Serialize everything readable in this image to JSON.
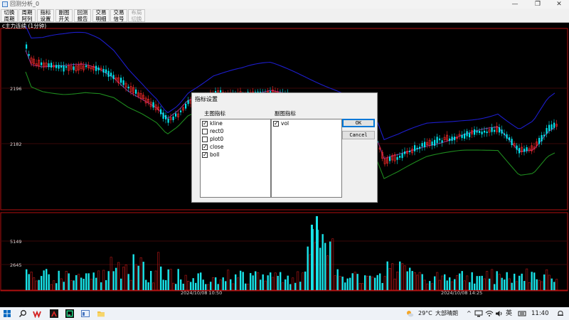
{
  "window": {
    "title": "回测分析_0",
    "controls": [
      "—",
      "❐",
      "✕"
    ]
  },
  "toolbar": {
    "buttons": [
      {
        "line1": "切换",
        "line2": "周期",
        "enabled": true
      },
      {
        "line1": "周期",
        "line2": "阿列",
        "enabled": true
      },
      {
        "line1": "指标",
        "line2": "设置",
        "enabled": true
      },
      {
        "line1": "副图",
        "line2": "开关",
        "enabled": true
      },
      {
        "line1": "回测",
        "line2": "报告",
        "enabled": true
      },
      {
        "line1": "交易",
        "line2": "明细",
        "enabled": true
      },
      {
        "line1": "交易",
        "line2": "信号",
        "enabled": true
      },
      {
        "line1": "布局",
        "line2": "切换",
        "enabled": false
      }
    ]
  },
  "chart": {
    "symbol_label": "c主力连续 (1分钟)",
    "main_ticks": [
      "2196",
      "2182"
    ],
    "sub_ticks": [
      "5149",
      "2645"
    ],
    "time_labels": [
      "2024/10/08 10:50",
      "2024/10/08 14:25"
    ],
    "colors": {
      "up": "#00e5ee",
      "down_outline": "#ff2b2b",
      "boll_upper": "#1d1dcc",
      "boll_mid": "#8a2a8a",
      "boll_lower": "#1e8a1e",
      "frame": "#b01010",
      "vol_up": "#18e3e8",
      "vol_down": "#c01818"
    }
  },
  "chart_data": {
    "type": "candlestick",
    "panels": [
      "kline",
      "vol"
    ],
    "main_yticks": [
      2196,
      2182
    ],
    "vol_yticks": [
      5149,
      2645
    ],
    "x_ticks": [
      "2024/10/08 10:50",
      "2024/10/08 14:25"
    ],
    "series": [
      {
        "name": "kline"
      },
      {
        "name": "boll"
      },
      {
        "name": "vol"
      }
    ]
  },
  "dialog": {
    "title": "指标设置",
    "main_header": "主图指标",
    "sub_header": "副图指标",
    "main_items": [
      {
        "label": "kline",
        "checked": true
      },
      {
        "label": "rect0",
        "checked": false
      },
      {
        "label": "plot0",
        "checked": false
      },
      {
        "label": "close",
        "checked": true
      },
      {
        "label": "boll",
        "checked": true
      }
    ],
    "sub_items": [
      {
        "label": "vol",
        "checked": true
      }
    ],
    "ok_label": "OK",
    "cancel_label": "Cancel"
  },
  "taskbar": {
    "weather_temp": "29°C",
    "weather_desc": "大部晴朗",
    "ime": "英",
    "time": "11:40",
    "icons": [
      "windows-icon",
      "search-icon",
      "wps-icon",
      "app-a-icon",
      "pycharm-icon",
      "backtest-app-icon",
      "file-explorer-icon"
    ]
  }
}
